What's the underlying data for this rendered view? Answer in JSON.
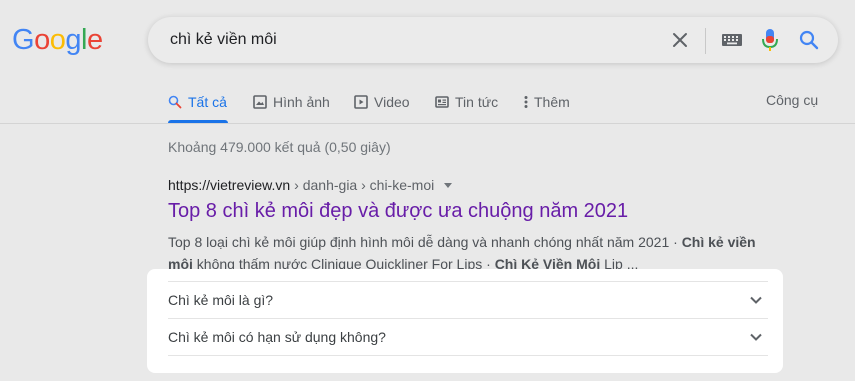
{
  "logo": {
    "letters": [
      "G",
      "o",
      "o",
      "g",
      "l",
      "e"
    ],
    "colors": [
      "#4285f4",
      "#ea4335",
      "#fbbc05",
      "#4285f4",
      "#34a853",
      "#ea4335"
    ]
  },
  "search": {
    "query": "chì kẻ viền môi"
  },
  "tabs": [
    {
      "label": "Tất cả",
      "icon": "search-icon",
      "active": true
    },
    {
      "label": "Hình ảnh",
      "icon": "image-icon"
    },
    {
      "label": "Video",
      "icon": "video-icon"
    },
    {
      "label": "Tin tức",
      "icon": "news-icon"
    },
    {
      "label": "Thêm",
      "icon": "more-icon"
    }
  ],
  "tools_label": "Công cụ",
  "stats": "Khoảng 479.000 kết quả (0,50 giây)",
  "result": {
    "domain": "https://vietreview.vn",
    "path": " › danh-gia › chi-ke-moi",
    "title": "Top 8 chì kẻ môi đẹp và được ưa chuộng năm 2021",
    "snippet": {
      "part1": "Top 8 loại chì kẻ môi giúp định hình môi dễ dàng và nhanh chóng nhất năm 2021 · ",
      "bold1": "Chì kẻ viền môi",
      "part2": " không thấm nước Clinique Quickliner For Lips · ",
      "bold2": "Chì Kẻ Viền Môi",
      "part3": " Lip ..."
    }
  },
  "faq": [
    {
      "question": "Chì kẻ môi là gì?"
    },
    {
      "question": "Chì kẻ môi có hạn sử dụng không?"
    }
  ],
  "colors": {
    "accent": "#1a73e8",
    "visited_link": "#681da8"
  }
}
